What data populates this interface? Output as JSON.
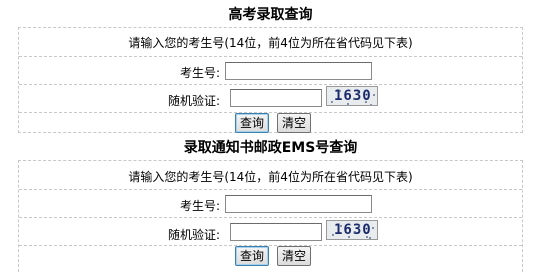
{
  "sections": [
    {
      "title": "高考录取查询",
      "notice": "请输入您的考生号(14位，前4位为所在省代码见下表)",
      "exam_label": "考生号:",
      "exam_value": "",
      "captcha_label": "随机验证:",
      "captcha_value": "",
      "captcha_text": "1630",
      "query_button": "查询",
      "clear_button": "清空"
    },
    {
      "title": "录取通知书邮政EMS号查询",
      "notice": "请输入您的考生号(14位，前4位为所在省代码见下表)",
      "exam_label": "考生号:",
      "exam_value": "",
      "captcha_label": "随机验证:",
      "captcha_value": "",
      "captcha_text": "1630",
      "query_button": "查询",
      "clear_button": "清空"
    }
  ]
}
